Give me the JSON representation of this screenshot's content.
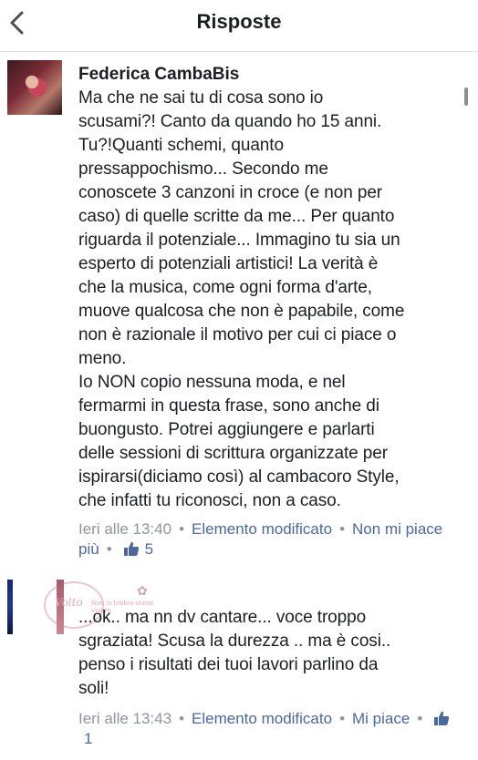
{
  "header": {
    "title": "Risposte"
  },
  "comments": [
    {
      "author": "Federica CambaBis",
      "text": "Ma che ne sai tu di cosa sono io\nscusami?! Canto da quando ho 15 anni.\nTu?!Quanti schemi, quanto\npressappochismo... Secondo me\nconoscete 3 canzoni in croce (e non per\ncaso) di quelle scritte da me... Per quanto\nriguarda il potenziale... Immagino tu sia un\nesperto di potenziali artistici! La verità è\nche la musica, come ogni forma d'arte,\nmuove qualcosa che non è papabile, come\nnon è razionale il motivo per cui ci piace o\nmeno.\nIo NON copio nessuna moda, e nel\nfermarmi in questa frase, sono anche di\nbuongusto. Potrei aggiungere e parlarti\ndelle sessioni di scrittura organizzate per\nispirarsi(diciamo così) al cambacoro Style,\nche infatti tu riconosci, non a caso.",
      "time": "Ieri alle 13:40",
      "edited": "Elemento modificato",
      "action": "Non mi piace più",
      "likes": "5"
    },
    {
      "author": "",
      "text": "...ok.. ma nn dv cantare... voce troppo\nsgraziata! Scusa la durezza .. ma è cosi..\npenso i risultati dei tuoi lavori parlino da\nsoli!",
      "time": "Ieri alle 13:43",
      "edited": "Elemento modificato",
      "action": "Mi piace",
      "likes": "1"
    }
  ],
  "watermark": {
    "main": "Volto",
    "small": "Non lo bibbia stand vivere"
  },
  "colors": {
    "link": "#4b67a1",
    "meta": "#90949c",
    "text": "#1c1e21"
  },
  "icons": {
    "back": "chevron-left-icon",
    "like": "thumbs-up-icon"
  }
}
